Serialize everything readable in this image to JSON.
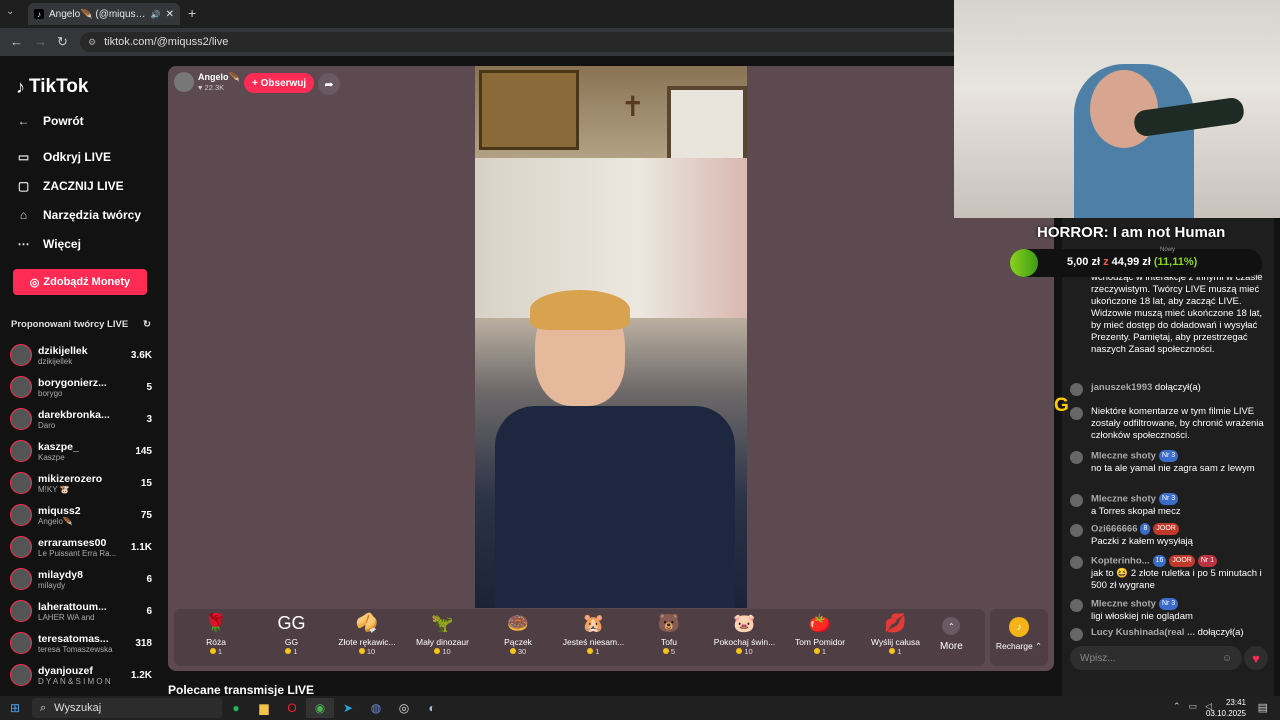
{
  "browser": {
    "tab_title": "Angelo🪶 (@miquss2) prow...",
    "tab_menu_icon": "chevron-down",
    "new_tab": "+",
    "url": "tiktok.com/@miquss2/live"
  },
  "sidebar": {
    "logo": "TikTok",
    "back": "Powrót",
    "nav": [
      "Odkryj LIVE",
      "ZACZNIJ LIVE",
      "Narzędzia twórcy",
      "Więcej"
    ],
    "coins_button": "Zdobądź Monety",
    "suggested_title": "Proponowani twórcy LIVE",
    "creators": [
      {
        "name": "dzikijellek",
        "sub": "dzikijellek",
        "count": "3.6K"
      },
      {
        "name": "borygonierz...",
        "sub": "borygo",
        "count": "5"
      },
      {
        "name": "darekbronka...",
        "sub": "Daro",
        "count": "3"
      },
      {
        "name": "kaszpe_",
        "sub": "Kaszpe",
        "count": "145"
      },
      {
        "name": "mikizerozero",
        "sub": "M!KY 🐮",
        "count": "15"
      },
      {
        "name": "miquss2",
        "sub": "Angelo🪶",
        "count": "75"
      },
      {
        "name": "erraramses00",
        "sub": "Le Puissant Erra Ra...",
        "count": "1.1K"
      },
      {
        "name": "milaydy8",
        "sub": "milaydy",
        "count": "6"
      },
      {
        "name": "laherattoum...",
        "sub": "LAHER WA and",
        "count": "6"
      },
      {
        "name": "teresatomas...",
        "sub": "teresa Tomaszewska",
        "count": "318"
      },
      {
        "name": "dyanjouzef",
        "sub": "D Y A N & S I M O N",
        "count": "1.2K"
      }
    ]
  },
  "player": {
    "streamer_name": "Angelo🪶",
    "streamer_likes": "22.3K",
    "follow": "+ Obserwuj",
    "gifts": [
      {
        "icon": "🌹",
        "name": "Róża",
        "price": "1"
      },
      {
        "icon": "GG",
        "name": "GG",
        "price": "1"
      },
      {
        "icon": "🥠",
        "name": "Złote rękawic...",
        "price": "10"
      },
      {
        "icon": "🦖",
        "name": "Mały dinozaur",
        "price": "10"
      },
      {
        "icon": "🍩",
        "name": "Pączek",
        "price": "30"
      },
      {
        "icon": "🐹",
        "name": "Jesteś niesam...",
        "price": "1"
      },
      {
        "icon": "🐻",
        "name": "Tofu",
        "price": "5"
      },
      {
        "icon": "🐷",
        "name": "Pokochaj świn...",
        "price": "10"
      },
      {
        "icon": "🍅",
        "name": "Tom Pomidor",
        "price": "1"
      },
      {
        "icon": "💋",
        "name": "Wyślij całusa",
        "price": "1"
      }
    ],
    "more": "More",
    "recharge": "Recharge ⌃"
  },
  "recommended_title": "Polecane transmisje LIVE",
  "overlay": {
    "title": "HORROR: I am not Human",
    "goal_label": "Nowy",
    "goal_current": "5,00 zł",
    "goal_sep": "z",
    "goal_target": "44,99 zł",
    "goal_percent": "(11,11%)",
    "goal_fraction": 0.1111,
    "letter": "G"
  },
  "chat": {
    "messages": [
      {
        "user": "",
        "text": "Witamy w TikTok LIVE! Baw się dobrze, wchodząc w interakcje z innymi w czasie rzeczywistym. Twórcy LIVE muszą mieć ukończone 18 lat, aby zacząć LIVE. Widzowie muszą mieć ukończone 18 lat, by mieć dostęp do doładowań i wysyłać Prezenty. Pamiętaj, aby przestrzegać naszych Zasad społeczności."
      },
      {
        "user": "januszek1993",
        "text": "dołączył(a)"
      },
      {
        "user": "",
        "text": "Niektóre komentarze w tym filmie LIVE zostały odfiltrowane, by chronić wrażenia członków społeczności."
      },
      {
        "user": "Mleczne shoty",
        "badge": "Nr 3",
        "text": "no ta ale yamal nie zagra sam z lewym"
      },
      {
        "user": "Mleczne shoty",
        "badge": "Nr 3",
        "text": "a Torres skopał mecz"
      },
      {
        "user": "Ozi666666",
        "badge": "8",
        "badge2": "JOOR",
        "text": "Paczki z kałem wysyłają"
      },
      {
        "user": "Kopterinho...",
        "badge": "16",
        "badge2": "JOOR",
        "badge3": "Nr 1",
        "text": "jak to 😆 2 złote ruletka i po 5 minutach i 500 zł wygrane"
      },
      {
        "user": "Mleczne shoty",
        "badge": "Nr 3",
        "text": "ligi włoskiej nie oglądam"
      },
      {
        "user": "Lucy Kushinada(real ...",
        "text": "dołączył(a)"
      }
    ],
    "input_placeholder": "Wpisz..."
  },
  "taskbar": {
    "search": "Wyszukaj",
    "time": "23:41",
    "date": "03.10.2025"
  }
}
